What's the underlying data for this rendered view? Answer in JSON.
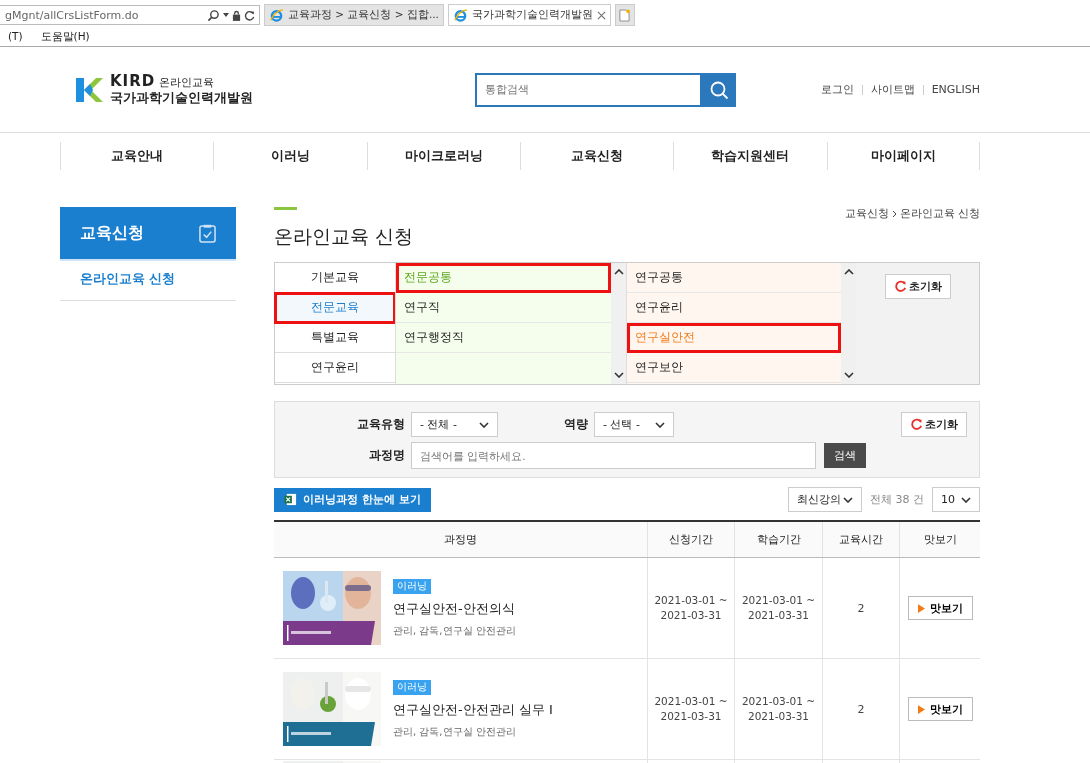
{
  "browser": {
    "address": "gMgnt/allCrsListForm.do",
    "tabs": [
      {
        "title": "교육과정 > 교육신청 > 집합...",
        "selected": false
      },
      {
        "title": "국가과학기술인력개발원",
        "selected": true
      }
    ],
    "menu": [
      "(T)",
      "도움말(H)"
    ]
  },
  "header": {
    "logo": {
      "brand": "KIRD",
      "sub": "온라인교육",
      "name": "국가과학기술인력개발원"
    },
    "search": {
      "placeholder": "통합검색"
    },
    "links": [
      "로그인",
      "사이트맵",
      "ENGLISH"
    ]
  },
  "nav": [
    "교육안내",
    "이러닝",
    "마이크로러닝",
    "교육신청",
    "학습지원센터",
    "마이페이지"
  ],
  "sidebar": {
    "title": "교육신청",
    "items": [
      {
        "label": "온라인교육 신청",
        "selected": true
      }
    ]
  },
  "page": {
    "title": "온라인교육 신청",
    "breadcrumb": [
      "교육신청",
      "온라인교육 신청"
    ]
  },
  "categories": {
    "level1": [
      {
        "label": "기본교육",
        "selected": false,
        "highlighted": false
      },
      {
        "label": "전문교육",
        "selected": true,
        "highlighted": true
      },
      {
        "label": "특별교육",
        "selected": false,
        "highlighted": false
      },
      {
        "label": "연구윤리",
        "selected": false,
        "highlighted": false
      }
    ],
    "level2": [
      {
        "label": "전문공통",
        "selected": true,
        "highlighted": true
      },
      {
        "label": "연구직",
        "selected": false,
        "highlighted": false
      },
      {
        "label": "연구행정직",
        "selected": false,
        "highlighted": false
      }
    ],
    "level3": [
      {
        "label": "연구공통",
        "selected": false,
        "highlighted": false
      },
      {
        "label": "연구윤리",
        "selected": false,
        "highlighted": false
      },
      {
        "label": "연구실안전",
        "selected": true,
        "highlighted": true
      },
      {
        "label": "연구보안",
        "selected": false,
        "highlighted": false
      }
    ],
    "reset": "초기화"
  },
  "filter": {
    "type_label": "교육유형",
    "type_value": "- 전체 -",
    "competency_label": "역량",
    "competency_value": "- 선택 -",
    "name_label": "과정명",
    "name_placeholder": "검색어를 입력하세요.",
    "search_button": "검색",
    "reset": "초기화"
  },
  "toolbar": {
    "overview_button": "이러닝과정 한눈에 보기",
    "sort": "최신강의",
    "total": "전체 38 건",
    "per_page": "10"
  },
  "table": {
    "columns": [
      "과정명",
      "신청기간",
      "학습기간",
      "교육시간",
      "맛보기"
    ],
    "rows": [
      {
        "tag": "이러닝",
        "title": "연구실안전-안전의식",
        "keywords": "관리, 감독,연구실 안전관리",
        "apply": "2021-03-01 ~ 2021-03-31",
        "study": "2021-03-01 ~ 2021-03-31",
        "hours": "2",
        "preview": "맛보기"
      },
      {
        "tag": "이러닝",
        "title": "연구실안전-안전관리 실무 I",
        "keywords": "관리, 감독,연구실 안전관리",
        "apply": "2021-03-01 ~ 2021-03-31",
        "study": "2021-03-01 ~ 2021-03-31",
        "hours": "2",
        "preview": "맛보기"
      }
    ],
    "partial_row": {
      "kind": "picture"
    }
  }
}
